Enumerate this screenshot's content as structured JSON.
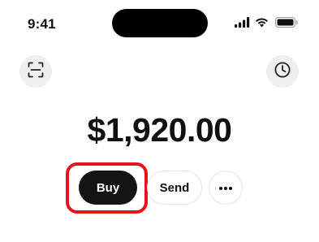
{
  "status_bar": {
    "time": "9:41",
    "icons": [
      "signal-icon",
      "wifi-icon",
      "battery-icon"
    ]
  },
  "header": {
    "left_button_icon": "scan-icon",
    "right_button_icon": "clock-icon"
  },
  "wallet": {
    "balance": "$1,920.00"
  },
  "actions": {
    "buy_label": "Buy",
    "send_label": "Send",
    "more_icon": "more-horizontal-icon"
  },
  "colors": {
    "highlight": "#e5141c",
    "primary_button": "#141414",
    "round_button_bg": "#efefef"
  }
}
